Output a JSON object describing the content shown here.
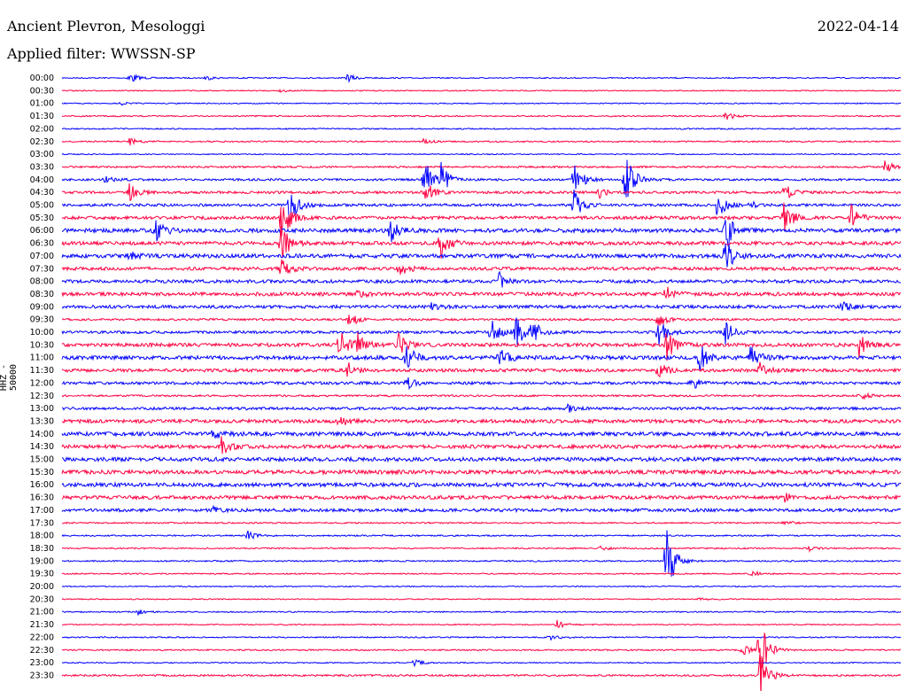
{
  "header": {
    "station": "Ancient Plevron, Mesologgi",
    "filter": "Applied filter: WWSSN-SP",
    "date": "2022-04-14"
  },
  "chart_data": {
    "type": "line",
    "title": "Ancient Plevron, Mesologgi",
    "subtitle": "Applied filter: WWSSN-SP",
    "date": "2022-04-14",
    "ylabel": "HHZ - 50000",
    "colors": {
      "even": "#0000ff",
      "odd": "#ff0040"
    },
    "rows": [
      {
        "time": "00:00",
        "noise": 0.6,
        "events": [
          {
            "x": 0.08,
            "amp": 8
          },
          {
            "x": 0.17,
            "amp": 3
          },
          {
            "x": 0.34,
            "amp": 5
          }
        ]
      },
      {
        "time": "00:30",
        "noise": 0.6,
        "events": [
          {
            "x": 0.26,
            "amp": 2
          }
        ]
      },
      {
        "time": "01:00",
        "noise": 0.6,
        "events": [
          {
            "x": 0.07,
            "amp": 2
          }
        ]
      },
      {
        "time": "01:30",
        "noise": 0.7,
        "events": [
          {
            "x": 0.79,
            "amp": 6
          }
        ]
      },
      {
        "time": "02:00",
        "noise": 0.7,
        "events": []
      },
      {
        "time": "02:30",
        "noise": 0.8,
        "events": [
          {
            "x": 0.08,
            "amp": 5
          },
          {
            "x": 0.43,
            "amp": 3
          }
        ]
      },
      {
        "time": "03:00",
        "noise": 0.6,
        "events": []
      },
      {
        "time": "03:30",
        "noise": 1.0,
        "events": [
          {
            "x": 0.98,
            "amp": 8
          }
        ]
      },
      {
        "time": "04:00",
        "noise": 1.2,
        "events": [
          {
            "x": 0.05,
            "amp": 4
          },
          {
            "x": 0.43,
            "amp": 30
          },
          {
            "x": 0.45,
            "amp": 25
          },
          {
            "x": 0.61,
            "amp": 22
          },
          {
            "x": 0.67,
            "amp": 40
          }
        ]
      },
      {
        "time": "04:30",
        "noise": 1.4,
        "events": [
          {
            "x": 0.08,
            "amp": 10
          },
          {
            "x": 0.43,
            "amp": 20
          },
          {
            "x": 0.64,
            "amp": 6
          },
          {
            "x": 0.86,
            "amp": 14
          }
        ]
      },
      {
        "time": "05:00",
        "noise": 1.5,
        "events": [
          {
            "x": 0.27,
            "amp": 25
          },
          {
            "x": 0.61,
            "amp": 18
          },
          {
            "x": 0.78,
            "amp": 20
          },
          {
            "x": 0.82,
            "amp": 4
          }
        ]
      },
      {
        "time": "05:30",
        "noise": 1.8,
        "events": [
          {
            "x": 0.26,
            "amp": 35
          },
          {
            "x": 0.86,
            "amp": 20
          },
          {
            "x": 0.94,
            "amp": 15
          }
        ]
      },
      {
        "time": "06:00",
        "noise": 2.2,
        "events": [
          {
            "x": 0.11,
            "amp": 16
          },
          {
            "x": 0.39,
            "amp": 16
          },
          {
            "x": 0.79,
            "amp": 26
          }
        ]
      },
      {
        "time": "06:30",
        "noise": 2.0,
        "events": [
          {
            "x": 0.26,
            "amp": 25
          },
          {
            "x": 0.45,
            "amp": 20
          }
        ]
      },
      {
        "time": "07:00",
        "noise": 2.2,
        "events": [
          {
            "x": 0.08,
            "amp": 6
          },
          {
            "x": 0.79,
            "amp": 22
          }
        ]
      },
      {
        "time": "07:30",
        "noise": 1.8,
        "events": [
          {
            "x": 0.26,
            "amp": 18
          },
          {
            "x": 0.4,
            "amp": 12
          }
        ]
      },
      {
        "time": "08:00",
        "noise": 1.8,
        "events": [
          {
            "x": 0.52,
            "amp": 12
          }
        ]
      },
      {
        "time": "08:30",
        "noise": 2.0,
        "events": [
          {
            "x": 0.35,
            "amp": 5
          },
          {
            "x": 0.72,
            "amp": 12
          }
        ]
      },
      {
        "time": "09:00",
        "noise": 1.8,
        "events": [
          {
            "x": 0.44,
            "amp": 4
          },
          {
            "x": 0.93,
            "amp": 5
          }
        ]
      },
      {
        "time": "09:30",
        "noise": 1.2,
        "events": [
          {
            "x": 0.34,
            "amp": 12
          },
          {
            "x": 0.71,
            "amp": 12
          }
        ]
      },
      {
        "time": "10:00",
        "noise": 1.5,
        "events": [
          {
            "x": 0.51,
            "amp": 18
          },
          {
            "x": 0.54,
            "amp": 22
          },
          {
            "x": 0.56,
            "amp": 15
          },
          {
            "x": 0.71,
            "amp": 18
          },
          {
            "x": 0.79,
            "amp": 16
          }
        ]
      },
      {
        "time": "10:30",
        "noise": 2.0,
        "events": [
          {
            "x": 0.33,
            "amp": 20
          },
          {
            "x": 0.35,
            "amp": 16
          },
          {
            "x": 0.4,
            "amp": 14
          },
          {
            "x": 0.72,
            "amp": 20
          },
          {
            "x": 0.95,
            "amp": 14
          }
        ]
      },
      {
        "time": "11:00",
        "noise": 2.2,
        "events": [
          {
            "x": 0.41,
            "amp": 16
          },
          {
            "x": 0.52,
            "amp": 14
          },
          {
            "x": 0.76,
            "amp": 18
          },
          {
            "x": 0.82,
            "amp": 14
          }
        ]
      },
      {
        "time": "11:30",
        "noise": 1.8,
        "events": [
          {
            "x": 0.34,
            "amp": 10
          },
          {
            "x": 0.71,
            "amp": 12
          },
          {
            "x": 0.83,
            "amp": 10
          }
        ]
      },
      {
        "time": "12:00",
        "noise": 1.6,
        "events": [
          {
            "x": 0.41,
            "amp": 8
          },
          {
            "x": 0.75,
            "amp": 8
          }
        ]
      },
      {
        "time": "12:30",
        "noise": 1.0,
        "events": [
          {
            "x": 0.95,
            "amp": 6
          }
        ]
      },
      {
        "time": "13:00",
        "noise": 1.5,
        "events": [
          {
            "x": 0.6,
            "amp": 6
          }
        ]
      },
      {
        "time": "13:30",
        "noise": 2.0,
        "events": [
          {
            "x": 0.33,
            "amp": 6
          }
        ]
      },
      {
        "time": "14:00",
        "noise": 2.2,
        "events": [
          {
            "x": 0.18,
            "amp": 6
          }
        ]
      },
      {
        "time": "14:30",
        "noise": 2.0,
        "events": [
          {
            "x": 0.19,
            "amp": 12
          }
        ]
      },
      {
        "time": "15:00",
        "noise": 2.2,
        "events": []
      },
      {
        "time": "15:30",
        "noise": 2.2,
        "events": []
      },
      {
        "time": "16:00",
        "noise": 2.2,
        "events": []
      },
      {
        "time": "16:30",
        "noise": 2.0,
        "events": [
          {
            "x": 0.86,
            "amp": 6
          }
        ]
      },
      {
        "time": "17:00",
        "noise": 1.8,
        "events": [
          {
            "x": 0.18,
            "amp": 3
          }
        ]
      },
      {
        "time": "17:30",
        "noise": 0.8,
        "events": [
          {
            "x": 0.86,
            "amp": 3
          }
        ]
      },
      {
        "time": "18:00",
        "noise": 0.8,
        "events": [
          {
            "x": 0.22,
            "amp": 6
          }
        ]
      },
      {
        "time": "18:30",
        "noise": 0.8,
        "events": [
          {
            "x": 0.64,
            "amp": 3
          },
          {
            "x": 0.89,
            "amp": 3
          }
        ]
      },
      {
        "time": "19:00",
        "noise": 0.8,
        "events": [
          {
            "x": 0.72,
            "amp": 45
          }
        ]
      },
      {
        "time": "19:30",
        "noise": 0.7,
        "events": [
          {
            "x": 0.82,
            "amp": 5
          }
        ]
      },
      {
        "time": "20:00",
        "noise": 0.6,
        "events": []
      },
      {
        "time": "20:30",
        "noise": 0.6,
        "events": [
          {
            "x": 0.76,
            "amp": 2
          }
        ]
      },
      {
        "time": "21:00",
        "noise": 0.7,
        "events": [
          {
            "x": 0.09,
            "amp": 3
          }
        ]
      },
      {
        "time": "21:30",
        "noise": 0.6,
        "events": [
          {
            "x": 0.59,
            "amp": 5
          }
        ]
      },
      {
        "time": "22:00",
        "noise": 0.7,
        "events": [
          {
            "x": 0.58,
            "amp": 4
          }
        ]
      },
      {
        "time": "22:30",
        "noise": 0.8,
        "events": [
          {
            "x": 0.81,
            "amp": 8
          },
          {
            "x": 0.83,
            "amp": 45
          }
        ]
      },
      {
        "time": "23:00",
        "noise": 0.6,
        "events": [
          {
            "x": 0.42,
            "amp": 5
          }
        ]
      },
      {
        "time": "23:30",
        "noise": 1.0,
        "events": [
          {
            "x": 0.83,
            "amp": 35
          }
        ]
      }
    ]
  }
}
